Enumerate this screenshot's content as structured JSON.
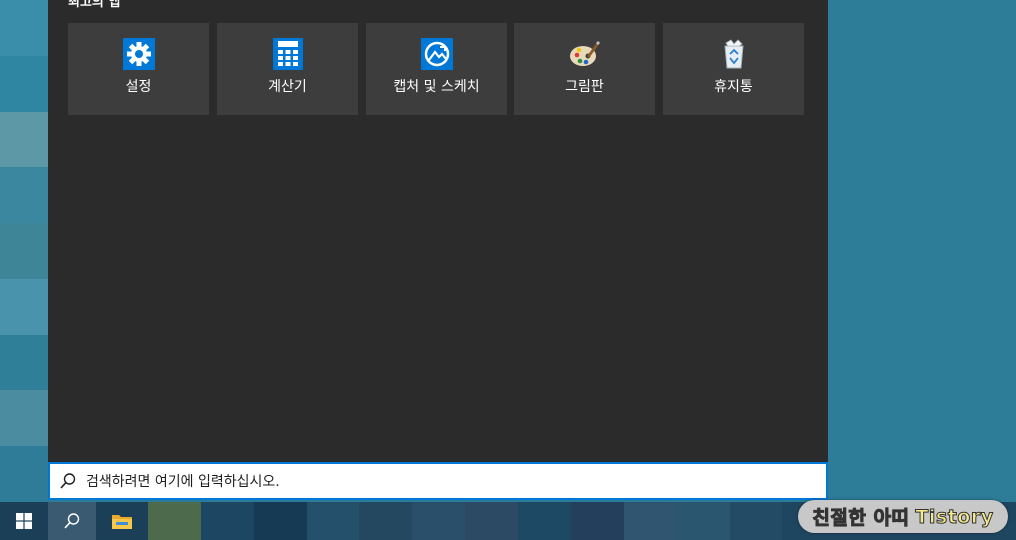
{
  "start_menu": {
    "section_title": "최고의 앱",
    "tiles": [
      {
        "label": "설정",
        "icon": "settings-gear-icon"
      },
      {
        "label": "계산기",
        "icon": "calculator-icon"
      },
      {
        "label": "캡처 및 스케치",
        "icon": "snip-sketch-icon"
      },
      {
        "label": "그림판",
        "icon": "paint-palette-icon"
      },
      {
        "label": "휴지통",
        "icon": "recycle-bin-icon"
      }
    ]
  },
  "search": {
    "placeholder": "검색하려면 여기에 입력하십시오.",
    "icon": "search-icon"
  },
  "taskbar": {
    "start_icon": "windows-logo-icon",
    "search_icon": "search-icon",
    "explorer_icon": "file-explorer-folder-icon"
  },
  "watermark": {
    "name": "친절한 아띠",
    "brand": "Tistory"
  },
  "colors": {
    "panel_bg": "#2b2b2b",
    "tile_bg": "#3d3d3d",
    "accent": "#0078d7",
    "taskbar_bg": "#1b3f57"
  }
}
